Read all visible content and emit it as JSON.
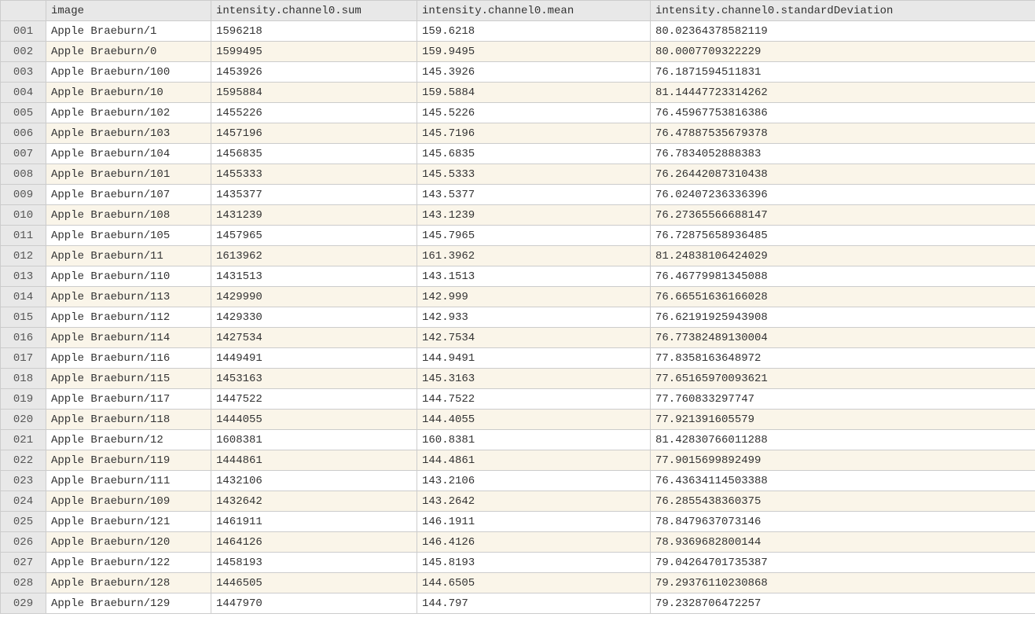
{
  "columns": {
    "rownum": "",
    "image": "image",
    "sum": "intensity.channel0.sum",
    "mean": "intensity.channel0.mean",
    "stddev": "intensity.channel0.standardDeviation"
  },
  "rows": [
    {
      "rownum": "001",
      "image": "Apple Braeburn/1",
      "sum": "1596218",
      "mean": "159.6218",
      "stddev": "80.02364378582119"
    },
    {
      "rownum": "002",
      "image": "Apple Braeburn/0",
      "sum": "1599495",
      "mean": "159.9495",
      "stddev": "80.0007709322229"
    },
    {
      "rownum": "003",
      "image": "Apple Braeburn/100",
      "sum": "1453926",
      "mean": "145.3926",
      "stddev": "76.1871594511831"
    },
    {
      "rownum": "004",
      "image": "Apple Braeburn/10",
      "sum": "1595884",
      "mean": "159.5884",
      "stddev": "81.14447723314262"
    },
    {
      "rownum": "005",
      "image": "Apple Braeburn/102",
      "sum": "1455226",
      "mean": "145.5226",
      "stddev": "76.45967753816386"
    },
    {
      "rownum": "006",
      "image": "Apple Braeburn/103",
      "sum": "1457196",
      "mean": "145.7196",
      "stddev": "76.47887535679378"
    },
    {
      "rownum": "007",
      "image": "Apple Braeburn/104",
      "sum": "1456835",
      "mean": "145.6835",
      "stddev": "76.7834052888383"
    },
    {
      "rownum": "008",
      "image": "Apple Braeburn/101",
      "sum": "1455333",
      "mean": "145.5333",
      "stddev": "76.26442087310438"
    },
    {
      "rownum": "009",
      "image": "Apple Braeburn/107",
      "sum": "1435377",
      "mean": "143.5377",
      "stddev": "76.02407236336396"
    },
    {
      "rownum": "010",
      "image": "Apple Braeburn/108",
      "sum": "1431239",
      "mean": "143.1239",
      "stddev": "76.27365566688147"
    },
    {
      "rownum": "011",
      "image": "Apple Braeburn/105",
      "sum": "1457965",
      "mean": "145.7965",
      "stddev": "76.72875658936485"
    },
    {
      "rownum": "012",
      "image": "Apple Braeburn/11",
      "sum": "1613962",
      "mean": "161.3962",
      "stddev": "81.24838106424029"
    },
    {
      "rownum": "013",
      "image": "Apple Braeburn/110",
      "sum": "1431513",
      "mean": "143.1513",
      "stddev": "76.46779981345088"
    },
    {
      "rownum": "014",
      "image": "Apple Braeburn/113",
      "sum": "1429990",
      "mean": "142.999",
      "stddev": "76.66551636166028"
    },
    {
      "rownum": "015",
      "image": "Apple Braeburn/112",
      "sum": "1429330",
      "mean": "142.933",
      "stddev": "76.62191925943908"
    },
    {
      "rownum": "016",
      "image": "Apple Braeburn/114",
      "sum": "1427534",
      "mean": "142.7534",
      "stddev": "76.77382489130004"
    },
    {
      "rownum": "017",
      "image": "Apple Braeburn/116",
      "sum": "1449491",
      "mean": "144.9491",
      "stddev": "77.8358163648972"
    },
    {
      "rownum": "018",
      "image": "Apple Braeburn/115",
      "sum": "1453163",
      "mean": "145.3163",
      "stddev": "77.65165970093621"
    },
    {
      "rownum": "019",
      "image": "Apple Braeburn/117",
      "sum": "1447522",
      "mean": "144.7522",
      "stddev": "77.760833297747"
    },
    {
      "rownum": "020",
      "image": "Apple Braeburn/118",
      "sum": "1444055",
      "mean": "144.4055",
      "stddev": "77.921391605579"
    },
    {
      "rownum": "021",
      "image": "Apple Braeburn/12",
      "sum": "1608381",
      "mean": "160.8381",
      "stddev": "81.42830766011288"
    },
    {
      "rownum": "022",
      "image": "Apple Braeburn/119",
      "sum": "1444861",
      "mean": "144.4861",
      "stddev": "77.9015699892499"
    },
    {
      "rownum": "023",
      "image": "Apple Braeburn/111",
      "sum": "1432106",
      "mean": "143.2106",
      "stddev": "76.43634114503388"
    },
    {
      "rownum": "024",
      "image": "Apple Braeburn/109",
      "sum": "1432642",
      "mean": "143.2642",
      "stddev": "76.2855438360375"
    },
    {
      "rownum": "025",
      "image": "Apple Braeburn/121",
      "sum": "1461911",
      "mean": "146.1911",
      "stddev": "78.8479637073146"
    },
    {
      "rownum": "026",
      "image": "Apple Braeburn/120",
      "sum": "1464126",
      "mean": "146.4126",
      "stddev": "78.9369682800144"
    },
    {
      "rownum": "027",
      "image": "Apple Braeburn/122",
      "sum": "1458193",
      "mean": "145.8193",
      "stddev": "79.04264701735387"
    },
    {
      "rownum": "028",
      "image": "Apple Braeburn/128",
      "sum": "1446505",
      "mean": "144.6505",
      "stddev": "79.29376110230868"
    },
    {
      "rownum": "029",
      "image": "Apple Braeburn/129",
      "sum": "1447970",
      "mean": "144.797",
      "stddev": "79.2328706472257"
    }
  ]
}
